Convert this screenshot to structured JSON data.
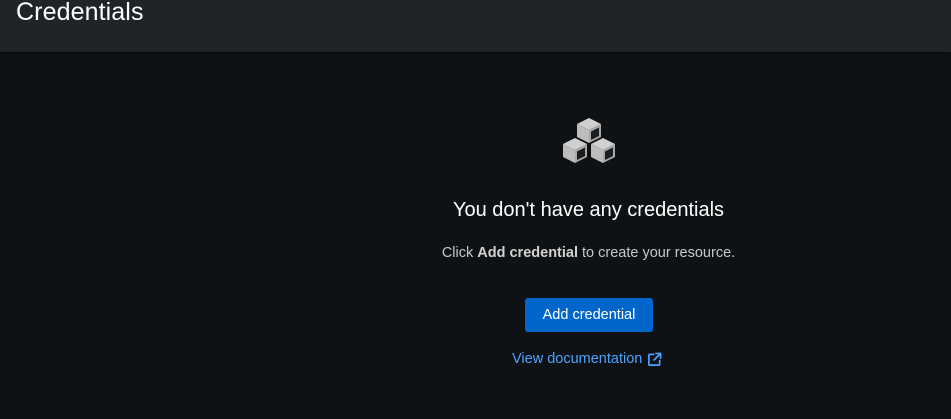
{
  "header": {
    "title": "Credentials"
  },
  "empty_state": {
    "icon": "cubes-icon",
    "heading": "You don't have any credentials",
    "body_prefix": "Click ",
    "body_bold": "Add credential",
    "body_suffix": " to create your resource.",
    "primary_button_label": "Add credential",
    "link_label": "View documentation",
    "link_icon": "external-link-icon"
  },
  "colors": {
    "background": "#0f1214",
    "header_background": "#212427",
    "primary": "#0066cc",
    "link": "#4da3ff",
    "icon": "#c7c7c7"
  }
}
